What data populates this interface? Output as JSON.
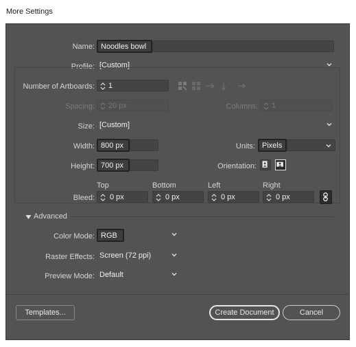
{
  "window": {
    "title": "More Settings"
  },
  "form": {
    "name": {
      "label": "Name:",
      "value": "Noodles bowl"
    },
    "profile": {
      "label": "Profile:",
      "value": "[Custom]"
    },
    "artboards": {
      "label": "Number of Artboards:",
      "value": "1"
    },
    "spacing": {
      "label": "Spacing:",
      "value": "20 px"
    },
    "columns": {
      "label": "Columns:",
      "value": "1"
    },
    "size": {
      "label": "Size:",
      "value": "[Custom]"
    },
    "width": {
      "label": "Width:",
      "value": "800 px"
    },
    "height": {
      "label": "Height:",
      "value": "700 px"
    },
    "units": {
      "label": "Units:",
      "value": "Pixels"
    },
    "orientation": {
      "label": "Orientation:"
    },
    "bleed": {
      "label": "Bleed:",
      "top_label": "Top",
      "bottom_label": "Bottom",
      "left_label": "Left",
      "right_label": "Right",
      "top": "0 px",
      "bottom": "0 px",
      "left": "0 px",
      "right": "0 px"
    }
  },
  "advanced": {
    "label": "Advanced",
    "color_mode": {
      "label": "Color Mode:",
      "value": "RGB"
    },
    "raster_effects": {
      "label": "Raster Effects:",
      "value": "Screen (72 ppi)"
    },
    "preview_mode": {
      "label": "Preview Mode:",
      "value": "Default"
    }
  },
  "buttons": {
    "templates": "Templates...",
    "create": "Create Document",
    "cancel": "Cancel"
  },
  "icons": [
    "spinner-icon",
    "chevron-down-icon",
    "grid-by-row-icon",
    "grid-by-column-icon",
    "arrange-by-row-icon",
    "arrange-by-column-icon",
    "right-to-left-icon",
    "portrait-icon",
    "landscape-icon",
    "link-icon",
    "triangle-down-icon"
  ]
}
